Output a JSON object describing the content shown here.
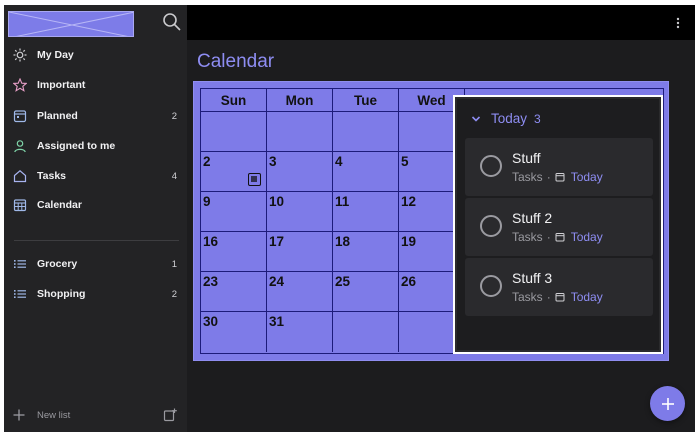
{
  "sidebar": {
    "items": [
      {
        "label": "My Day",
        "count": "",
        "icon": "sun-icon"
      },
      {
        "label": "Important",
        "count": "",
        "icon": "star-icon"
      },
      {
        "label": "Planned",
        "count": "2",
        "icon": "calendar-icon"
      },
      {
        "label": "Assigned to me",
        "count": "",
        "icon": "person-icon"
      },
      {
        "label": "Tasks",
        "count": "4",
        "icon": "home-icon"
      },
      {
        "label": "Calendar",
        "count": "",
        "icon": "calendar-grid-icon"
      }
    ],
    "lists": [
      {
        "label": "Grocery",
        "count": "1",
        "icon": "list-icon"
      },
      {
        "label": "Shopping",
        "count": "2",
        "icon": "list-icon"
      }
    ],
    "new_list_label": "New list"
  },
  "main": {
    "title": "Calendar"
  },
  "calendar": {
    "weekdays": [
      "Sun",
      "Mon",
      "Tue",
      "Wed"
    ],
    "weeks": [
      [
        "",
        "",
        "",
        ""
      ],
      [
        "2",
        "3",
        "4",
        "5"
      ],
      [
        "9",
        "10",
        "11",
        "12"
      ],
      [
        "16",
        "17",
        "18",
        "19"
      ],
      [
        "23",
        "24",
        "25",
        "26"
      ],
      [
        "30",
        "31",
        "",
        ""
      ]
    ]
  },
  "popup": {
    "header": "Today",
    "count": "3",
    "tasks": [
      {
        "title": "Stuff",
        "list": "Tasks",
        "separator": "·",
        "due": "Today"
      },
      {
        "title": "Stuff 2",
        "list": "Tasks",
        "separator": "·",
        "due": "Today"
      },
      {
        "title": "Stuff 3",
        "list": "Tasks",
        "separator": "·",
        "due": "Today"
      }
    ]
  },
  "colors": {
    "accent": "#8e8df2",
    "calendar_fill": "#7e7be8",
    "sidebar_bg": "#232325"
  }
}
